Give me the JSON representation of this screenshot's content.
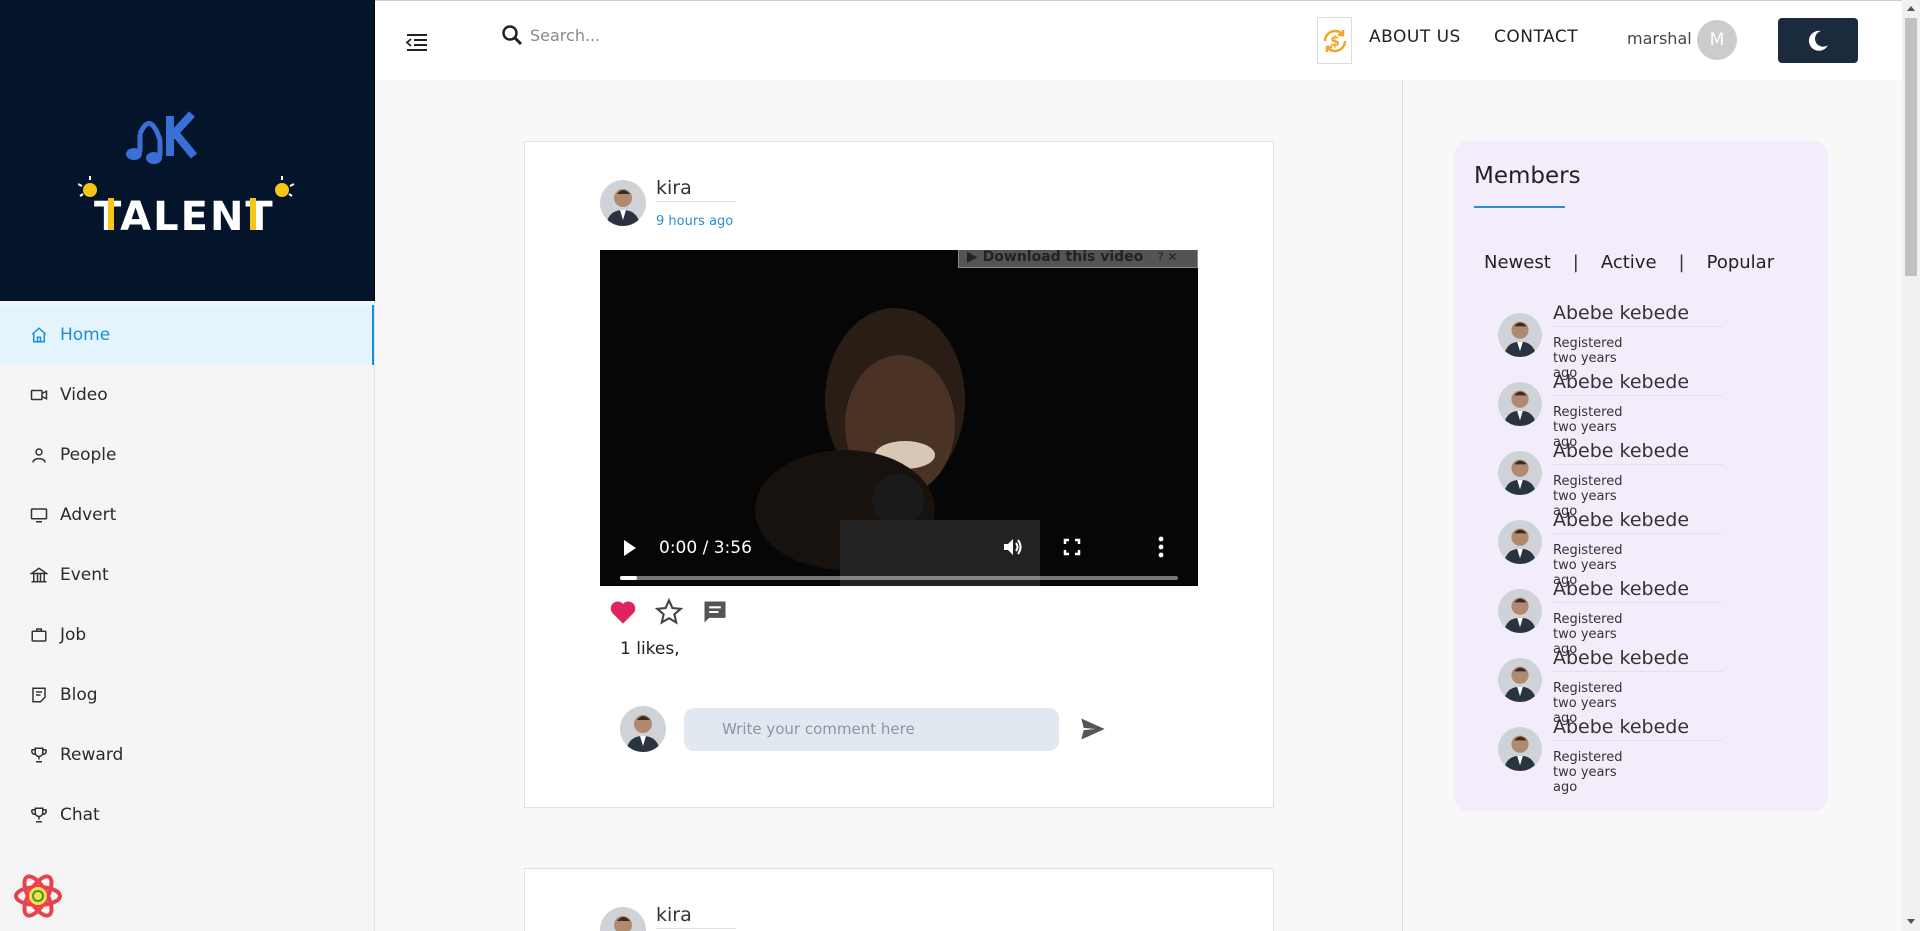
{
  "brand": {
    "logo_text": "MK TALENT"
  },
  "sidebar": {
    "items": [
      {
        "label": "Home",
        "icon": "home-icon",
        "active": true
      },
      {
        "label": "Video",
        "icon": "video-icon"
      },
      {
        "label": "People",
        "icon": "person-icon"
      },
      {
        "label": "Advert",
        "icon": "monitor-icon"
      },
      {
        "label": "Event",
        "icon": "building-icon"
      },
      {
        "label": "Job",
        "icon": "briefcase-icon"
      },
      {
        "label": "Blog",
        "icon": "document-icon"
      },
      {
        "label": "Reward",
        "icon": "trophy-icon"
      },
      {
        "label": "Chat",
        "icon": "trophy-icon"
      }
    ]
  },
  "header": {
    "search_placeholder": "Search...",
    "about_label": "ABOUT US",
    "contact_label": "CONTACT",
    "username": "marshal",
    "avatar_initial": "M"
  },
  "posts": [
    {
      "author": "kira",
      "time": "9 hours ago",
      "download_label": "▶ Download this video",
      "download_extra": "? ✕",
      "video_time": "0:00 / 3:56",
      "video_progress": 0.03,
      "likes_text": "1 likes,",
      "comment_placeholder": "Write your comment here"
    },
    {
      "author": "kira"
    }
  ],
  "members": {
    "title": "Members",
    "tabs": [
      "Newest",
      "Active",
      "Popular"
    ],
    "separator": "|",
    "list": [
      {
        "name": "Abebe kebede",
        "registered": "Registered two years ago"
      },
      {
        "name": "Abebe kebede",
        "registered": "Registered two years ago"
      },
      {
        "name": "Abebe kebede",
        "registered": "Registered two years ago"
      },
      {
        "name": "Abebe kebede",
        "registered": "Registered two years ago"
      },
      {
        "name": "Abebe kebede",
        "registered": "Registered two years ago"
      },
      {
        "name": "Abebe kebede",
        "registered": "Registered two years ago"
      },
      {
        "name": "Abebe kebede",
        "registered": "Registered two years ago"
      }
    ]
  },
  "colors": {
    "accent": "#2d8cd6",
    "sidebar_dark": "#04142b",
    "heart": "#e0245e",
    "members_bg": "#f3edfb"
  }
}
